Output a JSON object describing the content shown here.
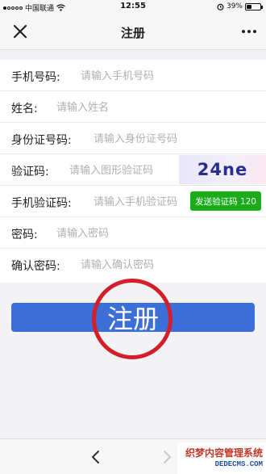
{
  "status_bar": {
    "carrier": "中国联通",
    "time": "12:55",
    "battery": "39%",
    "battery_level": 0.39
  },
  "nav": {
    "title": "注册",
    "close_icon": "close-icon",
    "more_icon": "more-icon"
  },
  "form": {
    "fields": [
      {
        "label": "手机号码:",
        "placeholder": "请输入手机号码"
      },
      {
        "label": "姓名:",
        "placeholder": "请输入姓名"
      },
      {
        "label": "身份证号码:",
        "placeholder": "请输入身份证号码"
      },
      {
        "label": "验证码:",
        "placeholder": "请输入图形验证码"
      },
      {
        "label": "手机验证码:",
        "placeholder": "请输入手机验证码"
      },
      {
        "label": "密码:",
        "placeholder": "请输入密码"
      },
      {
        "label": "确认密码:",
        "placeholder": "请输入确认密码"
      }
    ],
    "captcha_text": "24ne",
    "sms_button_label": "发送验证码 120"
  },
  "register_button": {
    "label": "注册",
    "color": "#3d6fd8",
    "highlight_color": "#d41f2b"
  },
  "bottom_bar": {
    "back_icon": "chevron-left-icon",
    "forward_icon": "chevron-right-icon"
  },
  "watermark": {
    "title": "织梦内容管理系统",
    "url": "DEDECMS.COM"
  }
}
